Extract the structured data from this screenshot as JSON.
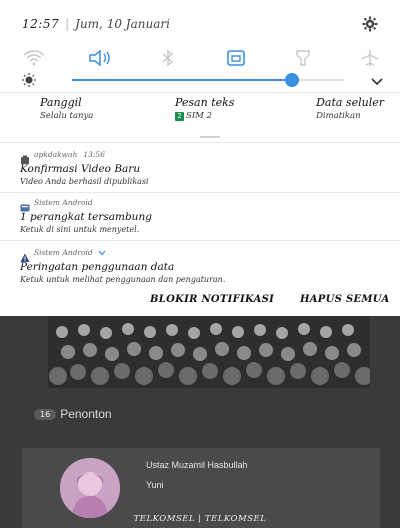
{
  "status": {
    "time": "12:57",
    "separator": "|",
    "date": "Jum, 10 Januari"
  },
  "icons": {
    "settings": "gear-icon",
    "quick_settings": [
      "wifi-icon",
      "sound-icon",
      "bluetooth-icon",
      "auto-rotate-icon",
      "flashlight-icon",
      "airplane-mode-icon"
    ],
    "brightness": "brightness-icon",
    "expand": "chevron-down-icon"
  },
  "brightness": {
    "level_percent": 81
  },
  "toggles": [
    {
      "title": "Panggil",
      "subtitle": "Selalu tanya",
      "badge": ""
    },
    {
      "title": "Pesan teks",
      "subtitle": "SIM 2",
      "badge": "2"
    },
    {
      "title": "Data seluler",
      "subtitle": "Dimatikan",
      "badge": ""
    }
  ],
  "notifications": [
    {
      "app": "apkdakwah",
      "time": "13:56",
      "title": "Konfirmasi Video Baru",
      "body": "Video Anda berhasil dipublikasi",
      "icon": "apk-app-icon"
    },
    {
      "app": "Sistem Android",
      "time": "",
      "title": "1 perangkat tersambung",
      "body": "Ketuk di sini untuk menyetel.",
      "icon": "android-system-icon"
    },
    {
      "app": "Sistem Android",
      "time": "",
      "title": "Peringatan penggunaan data",
      "body": "Ketuk untuk melihat penggunaan dan pengaturan.",
      "icon": "warning-icon"
    }
  ],
  "actions": {
    "block": "BLOKIR NOTIFIKASI",
    "clear": "HAPUS SEMUA"
  },
  "background_app": {
    "viewers_count": "16",
    "viewers_label": "Penonton",
    "user_name": "Ustaz Muzamil Hasbullah",
    "user_sub": "Yuni"
  },
  "carrier": "TELKOMSEL | TELKOMSEL",
  "colors": {
    "accent": "#3b8fe0",
    "sim_badge": "#1c8f4a",
    "shade_bg": "#ffffff",
    "dim_bg": "#3a3a3a"
  }
}
